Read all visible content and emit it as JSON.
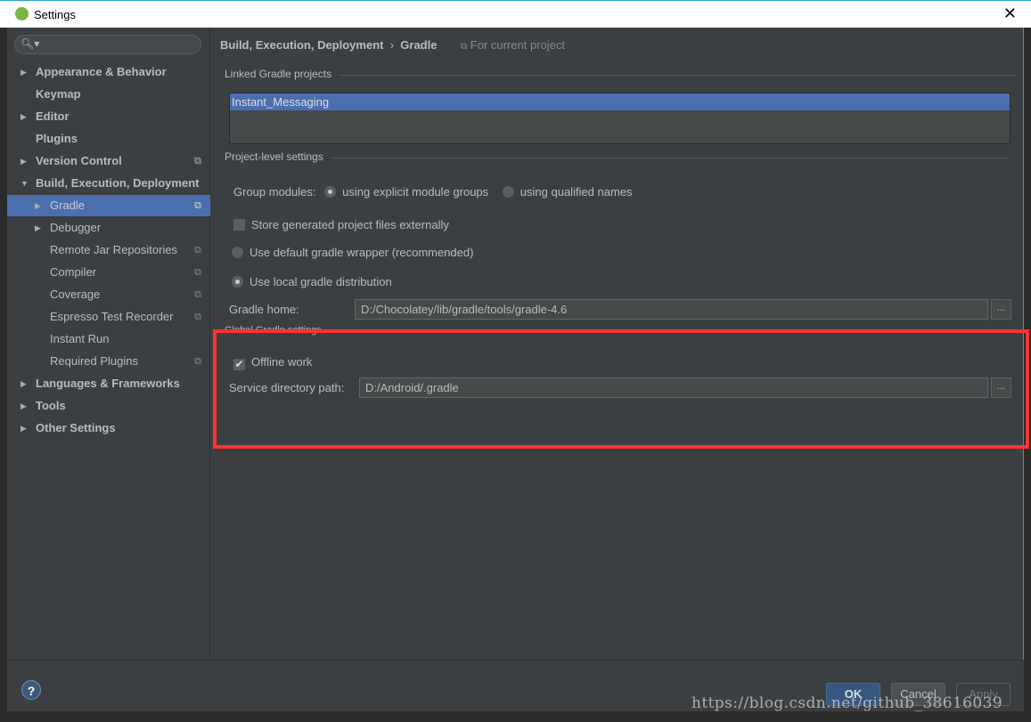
{
  "window": {
    "title": "Settings",
    "close": "✕"
  },
  "sidebar": {
    "search_placeholder": "",
    "items": [
      {
        "label": "Appearance & Behavior",
        "bold": true,
        "arrow": "▶"
      },
      {
        "label": "Keymap",
        "bold": true
      },
      {
        "label": "Editor",
        "bold": true,
        "arrow": "▶"
      },
      {
        "label": "Plugins",
        "bold": true
      },
      {
        "label": "Version Control",
        "bold": true,
        "arrow": "▶",
        "copy": true
      },
      {
        "label": "Build, Execution, Deployment",
        "bold": true,
        "arrow": "▼"
      },
      {
        "label": "Gradle",
        "arrow": "▶",
        "copy": true,
        "selected": true
      },
      {
        "label": "Debugger",
        "arrow": "▶"
      },
      {
        "label": "Remote Jar Repositories",
        "copy": true
      },
      {
        "label": "Compiler",
        "copy": true
      },
      {
        "label": "Coverage",
        "copy": true
      },
      {
        "label": "Espresso Test Recorder",
        "copy": true
      },
      {
        "label": "Instant Run"
      },
      {
        "label": "Required Plugins",
        "copy": true
      },
      {
        "label": "Languages & Frameworks",
        "bold": true,
        "arrow": "▶"
      },
      {
        "label": "Tools",
        "bold": true,
        "arrow": "▶"
      },
      {
        "label": "Other Settings",
        "bold": true,
        "arrow": "▶"
      }
    ]
  },
  "main": {
    "breadcrumb": "Build, Execution, Deployment",
    "breadcrumb_sep": "›",
    "page": "Gradle",
    "scope": "For current project",
    "linked_title": "Linked Gradle projects",
    "linked_projects": [
      "Instant_Messaging"
    ],
    "project_level_title": "Project-level settings",
    "group_modules_label": "Group modules:",
    "group_opt1": "using explicit module groups",
    "group_opt2": "using qualified names",
    "store_externally": "Store generated project files externally",
    "default_wrapper": "Use default gradle wrapper (recommended)",
    "local_dist": "Use local gradle distribution",
    "gradle_home_label": "Gradle home:",
    "gradle_home_value": "D:/Chocolatey/lib/gradle/tools/gradle-4.6",
    "global_title": "Global Gradle settings",
    "offline_work": "Offline work",
    "service_dir_label": "Service directory path:",
    "service_dir_value": "D:/Android/.gradle",
    "browse": "..."
  },
  "footer": {
    "help": "?",
    "ok": "OK",
    "cancel": "Cancel",
    "apply": "Apply"
  },
  "watermark": "https://blog.csdn.net/github_38616039",
  "colors": {
    "selection": "#4b6eaf",
    "highlight_box": "#ff3333",
    "panel": "#3c3f41"
  }
}
